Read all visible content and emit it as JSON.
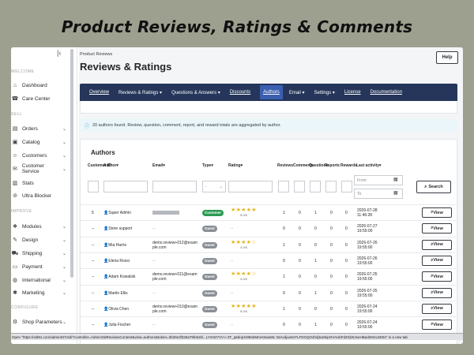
{
  "banner": "Product Reviews, Ratings & Comments",
  "sidebar": {
    "collapse_icon": "collapse-icon",
    "sections": [
      {
        "label": "WELCOME",
        "y": 0
      },
      {
        "label": "SELL"
      },
      {
        "label": "IMPROVE"
      },
      {
        "label": "CONFIGURE"
      }
    ],
    "items": [
      {
        "label": "Dashboard",
        "icon": "dashboard-icon",
        "chev": false
      },
      {
        "label": "Care Center",
        "icon": "care-icon",
        "chev": false
      },
      {
        "label": "Orders",
        "icon": "orders-icon",
        "chev": true
      },
      {
        "label": "Catalog",
        "icon": "catalog-icon",
        "chev": true
      },
      {
        "label": "Customers",
        "icon": "customers-icon",
        "chev": true
      },
      {
        "label": "Customer Service",
        "icon": "service-icon",
        "chev": true
      },
      {
        "label": "Stats",
        "icon": "stats-icon",
        "chev": false
      },
      {
        "label": "Ultra Blocker",
        "icon": "blocker-icon",
        "chev": false
      },
      {
        "label": "Modules",
        "icon": "modules-icon",
        "chev": true
      },
      {
        "label": "Design",
        "icon": "design-icon",
        "chev": true
      },
      {
        "label": "Shipping",
        "icon": "shipping-icon",
        "chev": true
      },
      {
        "label": "Payment",
        "icon": "payment-icon",
        "chev": true
      },
      {
        "label": "International",
        "icon": "international-icon",
        "chev": true
      },
      {
        "label": "Marketing",
        "icon": "marketing-icon",
        "chev": true
      },
      {
        "label": "Shop Parameters",
        "icon": "parameters-icon",
        "chev": true
      }
    ]
  },
  "header": {
    "breadcrumb": "Product Reviews",
    "title": "Reviews & Ratings",
    "help": "Help"
  },
  "tabs": [
    {
      "label": "Overview",
      "dropdown": false,
      "active": false
    },
    {
      "label": "Reviews & Ratings",
      "dropdown": true,
      "active": false
    },
    {
      "label": "Questions & Answers",
      "dropdown": true,
      "active": false
    },
    {
      "label": "Discounts",
      "dropdown": false,
      "active": false
    },
    {
      "label": "Authors",
      "dropdown": false,
      "active": true
    },
    {
      "label": "Email",
      "dropdown": true,
      "active": false
    },
    {
      "label": "Settings",
      "dropdown": true,
      "active": false
    },
    {
      "label": "License",
      "dropdown": false,
      "active": false
    },
    {
      "label": "Documentation",
      "dropdown": false,
      "active": false
    }
  ],
  "info": "20 authors found. Review, question, comment, report, and reward totals are aggregated by author.",
  "table": {
    "title": "Authors",
    "headers": [
      "Customer ID",
      "Author",
      "Email",
      "Type",
      "Rating",
      "Reviews",
      "Comments",
      "Questions",
      "Reports",
      "Rewards",
      "Last activity"
    ],
    "filters": {
      "type_value": "-",
      "from_placeholder": "From",
      "to_placeholder": "To",
      "search": "Search"
    },
    "view_label": "View",
    "rows": [
      {
        "id": "5",
        "author": "Super Admin",
        "email": "",
        "type": "Customer",
        "stars": "★★★★★",
        "score": "5.0/5",
        "reviews": "1",
        "comments": "0",
        "questions": "1",
        "reports": "0",
        "rewards": "0",
        "date": "2026-07-28",
        "time": "11:46:28"
      },
      {
        "id": "--",
        "author": "Store support",
        "email": "",
        "type": "Guest",
        "stars": "",
        "score": "",
        "reviews": "0",
        "comments": "0",
        "questions": "0",
        "reports": "0",
        "rewards": "0",
        "date": "2026-07-27",
        "time": "19:55:00"
      },
      {
        "id": "--",
        "author": "Mia Harris",
        "email": "demo.review+012@example.com",
        "type": "Guest",
        "stars": "★★★★☆",
        "score": "4.0/5",
        "reviews": "1",
        "comments": "0",
        "questions": "0",
        "reports": "0",
        "rewards": "0",
        "date": "2026-07-26",
        "time": "19:55:00"
      },
      {
        "id": "--",
        "author": "Elena Rossi",
        "email": "",
        "type": "Guest",
        "stars": "",
        "score": "",
        "reviews": "0",
        "comments": "0",
        "questions": "1",
        "reports": "0",
        "rewards": "0",
        "date": "2026-07-26",
        "time": "19:55:00"
      },
      {
        "id": "--",
        "author": "Adam Kowalski",
        "email": "demo.review+011@example.com",
        "type": "Guest",
        "stars": "★★★★☆",
        "score": "4.0/5",
        "reviews": "1",
        "comments": "0",
        "questions": "0",
        "reports": "0",
        "rewards": "0",
        "date": "2026-07-25",
        "time": "19:55:00"
      },
      {
        "id": "--",
        "author": "Martin Ellis",
        "email": "",
        "type": "Guest",
        "stars": "",
        "score": "",
        "reviews": "0",
        "comments": "0",
        "questions": "1",
        "reports": "0",
        "rewards": "0",
        "date": "2026-07-25",
        "time": "19:55:00"
      },
      {
        "id": "--",
        "author": "Olivia Chen",
        "email": "demo.review+010@example.com",
        "type": "Guest",
        "stars": "★★★★★",
        "score": "5.0/5",
        "reviews": "1",
        "comments": "0",
        "questions": "0",
        "reports": "0",
        "rewards": "0",
        "date": "2026-07-24",
        "time": "19:55:00"
      },
      {
        "id": "--",
        "author": "Julia Fischer",
        "email": "",
        "type": "Guest",
        "stars": "",
        "score": "",
        "reviews": "0",
        "comments": "0",
        "questions": "1",
        "reports": "0",
        "rewards": "0",
        "date": "2026-07-24",
        "time": "19:55:00"
      }
    ]
  },
  "status_bar": "Open \"https://xtd91.com/admin027xtd/?controller=AdminXtdReviewsContent&view=authors&token=3b30e3f329a79fe62kl...LYm027VV-c-3T_q6dnjHz89ebMmH3wwML¨s6AvdjxaSsTLFDGQO4hdjSaSkpOVAUbFdZS)WJveHBad29mL5D04\" in a new tab"
}
